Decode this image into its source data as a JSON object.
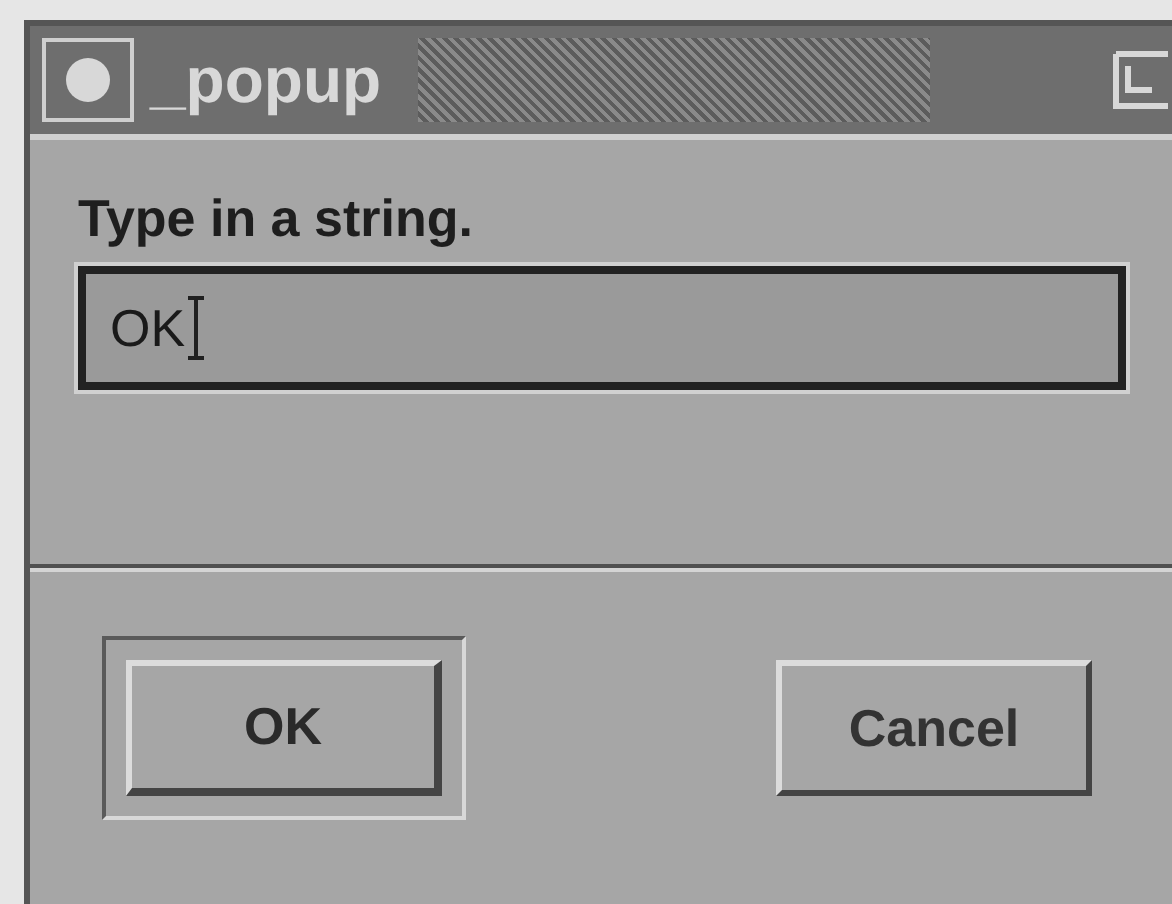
{
  "window": {
    "title": "_popup"
  },
  "prompt": {
    "label": "Type in a string.",
    "value": "OK"
  },
  "buttons": [
    {
      "label": "OK",
      "default": true
    },
    {
      "label": "Cancel",
      "default": false
    }
  ]
}
